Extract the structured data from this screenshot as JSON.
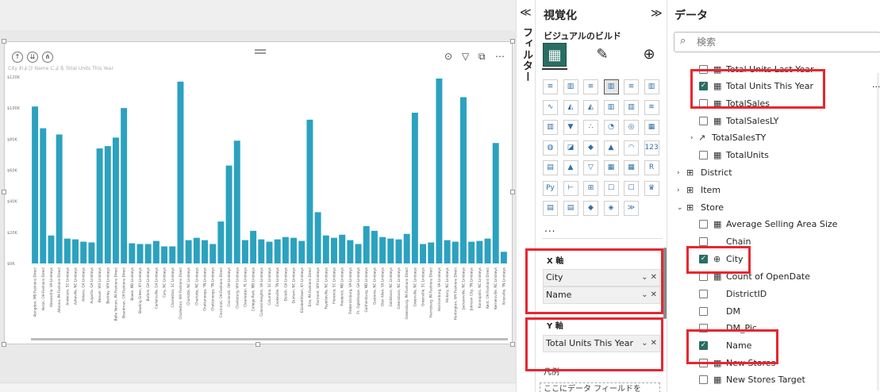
{
  "visual": {
    "title": "City および Name による Total Units This Year",
    "icons": {
      "drill_up": "arrow-up-icon",
      "drill_down": "arrow-down-icon",
      "expand": "expand-icon"
    }
  },
  "chart_data": {
    "type": "bar",
    "ylabel": "",
    "xlabel": "",
    "ylim": [
      0,
      120000
    ],
    "yticks": [
      "$0K",
      "$20K",
      "$40K",
      "$60K",
      "$80K",
      "$100K",
      "$120K"
    ],
    "categories": [
      "Abingdon, MD Fashions Direct",
      "Akron, OH Fashions Direct",
      "Alexandria, VA Lindseys",
      "Altoona, PA Fashions Direct",
      "Anderson, SC Lindseys",
      "Asheville, NC Lindseys",
      "Athens, GA Lindseys",
      "Augusta, GA Lindseys",
      "Beaver, WV Lindseys",
      "Beckley, WV Lindseys",
      "Belle Vernon, PA Fashions Direct",
      "Boardman, OH Fashions Direct",
      "Bowie, MD Lindseys",
      "Bowling Green, KY Lindseys",
      "Buford, GA Lindseys",
      "Cartersville, GA Lindseys",
      "Cary, NC Lindseys",
      "Charleston, SC Lindseys",
      "Charleston, WV Fashions Direct",
      "Charlotte, NC Lindseys",
      "Charlotte, NC Lindseys",
      "Chattanooga, TN Lindseys",
      "Chattanooga, TN Lindseys",
      "Cincinnati, OH Fashions Direct",
      "Cincinnati, OH Lindseys",
      "Clarksburg, WV Lindseys",
      "Clearwater, FL Lindseys",
      "College Park, MD Lindseys",
      "Colonial Heights, VA Lindseys",
      "Columbia, SC Lindseys",
      "Cookeville, TN Lindseys",
      "Duluth, GA Lindseys",
      "Durham, NC Lindseys",
      "Elizabethtown, KY Lindseys",
      "Erie, PA Fashions Direct",
      "Fairmont, WV Lindseys",
      "Fayetteville, NC Lindseys",
      "Florence, SC Lindseys",
      "Frederick, MD Lindseys",
      "Fredericksburg, VA Lindseys",
      "Ft. Oglethorpe, GA Lindseys",
      "Gaithersburg, MD Lindseys",
      "Gastonia, NC Lindseys",
      "Glen Allen, VA Lindseys",
      "Goldsboro, NC Lindseys",
      "Greensboro, NC Lindseys",
      "Greensburg, PA Fashions Direct",
      "Greenville, NC Lindseys",
      "Greenville, SC Lindseys",
      "Harrisburg, PA Fashions Direct",
      "Harrisonburg, VA Lindseys",
      "Hickory, NC Lindseys",
      "Huntington, WV Fashions Direct",
      "Jacksonville, NC Lindseys",
      "Johnson City, TN Lindseys",
      "Kannapolis, NC Lindseys",
      "Kent, OH Fashions Direct",
      "Kernersville, NC Lindseys",
      "Knoxville, TN Lindseys"
    ],
    "values": [
      101000,
      87000,
      18000,
      83000,
      16000,
      15500,
      14000,
      13500,
      74000,
      75500,
      81000,
      100000,
      13000,
      12500,
      12500,
      14500,
      11000,
      11000,
      117000,
      15000,
      16500,
      15000,
      12500,
      27000,
      63000,
      79000,
      15000,
      21000,
      15500,
      14000,
      15500,
      17000,
      16500,
      14500,
      92500,
      33000,
      18000,
      16500,
      18500,
      15000,
      12500,
      24000,
      21000,
      17000,
      16000,
      15500,
      19000,
      97000,
      12500,
      13500,
      119000,
      15000,
      14000,
      107000,
      14000,
      14500,
      16000,
      77500,
      7500
    ]
  },
  "filters": {
    "label": "フィルター",
    "collapse": "≪"
  },
  "viz_pane": {
    "title": "視覚化",
    "expand": "≫",
    "subtitle": "ビジュアルのビルド",
    "more": "...",
    "x_axis_label": "X 軸",
    "x_fields": [
      "City",
      "Name"
    ],
    "y_axis_label": "Y 軸",
    "y_fields": [
      "Total Units This Year"
    ],
    "legend_label": "凡例",
    "legend_placeholder": "ここにデータ フィールドを",
    "visual_icons": [
      "stacked-bar-icon",
      "stacked-column-icon",
      "clustered-bar-icon",
      "clustered-column-icon",
      "100-bar-icon",
      "100-column-icon",
      "line-icon",
      "area-icon",
      "stacked-area-icon",
      "line-column-icon",
      "line-clustered-icon",
      "ribbon-icon",
      "waterfall-icon",
      "funnel-icon",
      "scatter-icon",
      "pie-icon",
      "donut-icon",
      "treemap-icon",
      "map-icon",
      "filled-map-icon",
      "shape-map-icon",
      "azure-map-icon",
      "gauge-icon",
      "card-icon",
      "multirow-card-icon",
      "kpi-icon",
      "slicer-icon",
      "table-icon",
      "matrix-icon",
      "r-visual-icon",
      "python-visual-icon",
      "key-influencers-icon",
      "decomposition-tree-icon",
      "qa-icon",
      "narrative-icon",
      "goals-icon",
      "paginated-icon",
      "metrics-icon",
      "power-apps-icon",
      "power-automate-icon",
      "chevron-icon"
    ],
    "icon_glyphs": [
      "≡",
      "▥",
      "≡",
      "▥",
      "≡",
      "▥",
      "∿",
      "◭",
      "◭",
      "▥",
      "▥",
      "≋",
      "▥",
      "▼",
      "∴",
      "◔",
      "◎",
      "▦",
      "◍",
      "◪",
      "◆",
      "▲",
      "◠",
      "123",
      "▤",
      "▲",
      "▽",
      "▦",
      "▦",
      "R",
      "Py",
      "⊢",
      "⊞",
      "☐",
      "☐",
      "♛",
      "▤",
      "▤",
      "◆",
      "◈",
      "≫"
    ]
  },
  "data_pane": {
    "title": "データ",
    "search_placeholder": "検索",
    "fields": [
      {
        "type": "measure",
        "name": "Total Units Last Year",
        "checked": false
      },
      {
        "type": "measure",
        "name": "Total Units This Year",
        "checked": true
      },
      {
        "type": "measure",
        "name": "TotalSales",
        "checked": false
      },
      {
        "type": "measure",
        "name": "TotalSalesLY",
        "checked": false
      },
      {
        "type": "kpi",
        "name": "TotalSalesTY",
        "checked": false
      },
      {
        "type": "measure",
        "name": "TotalUnits",
        "checked": false
      },
      {
        "type": "table",
        "name": "District"
      },
      {
        "type": "table",
        "name": "Item"
      },
      {
        "type": "table",
        "name": "Store"
      },
      {
        "type": "measure",
        "name": "Average Selling Area Size",
        "checked": false
      },
      {
        "type": "field",
        "name": "Chain",
        "checked": false
      },
      {
        "type": "geo",
        "name": "City",
        "checked": true
      },
      {
        "type": "measure",
        "name": "Count of OpenDate",
        "checked": false
      },
      {
        "type": "field",
        "name": "DistrictID",
        "checked": false
      },
      {
        "type": "field",
        "name": "DM",
        "checked": false
      },
      {
        "type": "field",
        "name": "DM_Pic",
        "checked": false
      },
      {
        "type": "field",
        "name": "Name",
        "checked": true
      },
      {
        "type": "measure",
        "name": "New Stores",
        "checked": false
      },
      {
        "type": "measure",
        "name": "New Stores Target",
        "checked": false
      }
    ],
    "more_options": "..."
  },
  "colors": {
    "bar": "#2ba2bf",
    "accent": "#2a6e63",
    "highlight": "#e8262f"
  }
}
